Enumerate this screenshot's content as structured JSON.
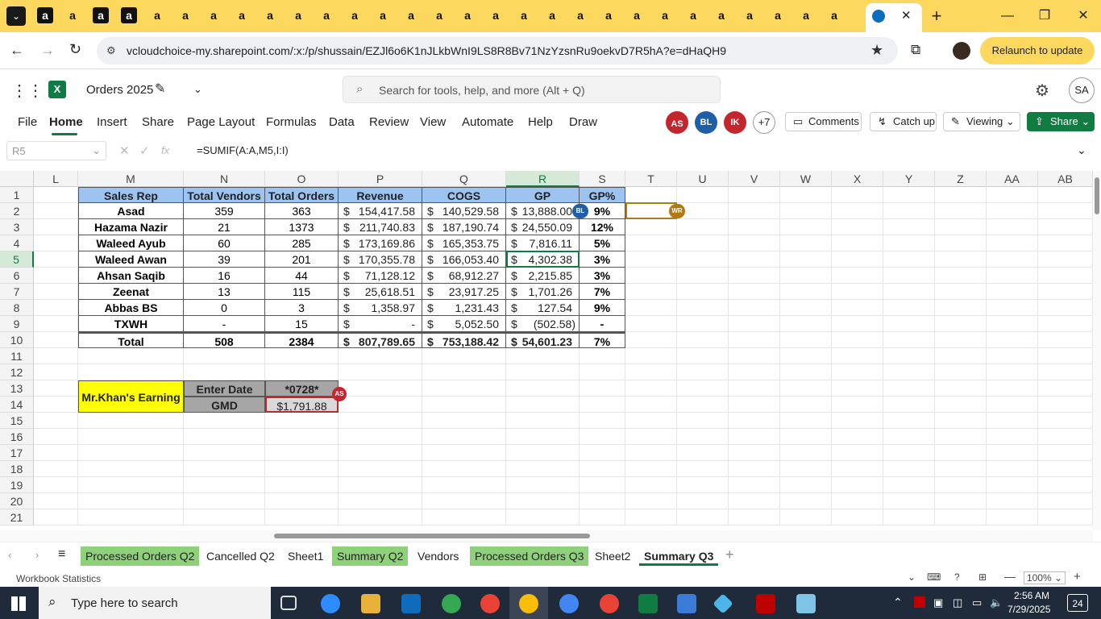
{
  "browser": {
    "url": "vcloudchoice-my.sharepoint.com/:x:/p/shussain/EZJl6o6K1nJLkbWnI9LS8R8Bv71NzYzsnRu9oekvD7R5hA?e=dHaQH9",
    "relaunch_label": "Relaunch to update",
    "tab_icon_letter": "a"
  },
  "app": {
    "title": "Orders 2025",
    "search_placeholder": "Search for tools, help, and more (Alt + Q)",
    "user_initials": "SA"
  },
  "ribbon": {
    "tabs": [
      "File",
      "Home",
      "Insert",
      "Share",
      "Page Layout",
      "Formulas",
      "Data",
      "Review",
      "View",
      "Automate",
      "Help",
      "Draw"
    ],
    "active_tab": "Home",
    "collaborators": [
      {
        "initials": "AS",
        "color": "#c4262e"
      },
      {
        "initials": "BL",
        "color": "#1f5fa8"
      },
      {
        "initials": "IK",
        "color": "#c4262e"
      }
    ],
    "more_collaborators": "+7",
    "comments_label": "Comments",
    "catchup_label": "Catch up",
    "viewing_label": "Viewing",
    "share_label": "Share"
  },
  "formula_bar": {
    "name_box": "R5",
    "fx": "fx",
    "formula": "=SUMIF(A:A,M5,I:I)"
  },
  "columns": [
    "L",
    "M",
    "N",
    "O",
    "P",
    "Q",
    "R",
    "S",
    "T",
    "U",
    "V",
    "W",
    "X",
    "Y",
    "Z",
    "AA",
    "AB"
  ],
  "rows": [
    "1",
    "2",
    "3",
    "4",
    "5",
    "6",
    "7",
    "8",
    "9",
    "10",
    "11",
    "12",
    "13",
    "14",
    "15",
    "16",
    "17",
    "18",
    "19",
    "20",
    "21"
  ],
  "table": {
    "headers": [
      "Sales Rep",
      "Total Vendors",
      "Total Orders",
      "Revenue",
      "COGS",
      "GP",
      "GP%"
    ],
    "rows": [
      [
        "Asad",
        "359",
        "363",
        "154,417.58",
        "140,529.58",
        "13,888.00",
        "9%"
      ],
      [
        "Hazama Nazir",
        "21",
        "1373",
        "211,740.83",
        "187,190.74",
        "24,550.09",
        "12%"
      ],
      [
        "Waleed Ayub",
        "60",
        "285",
        "173,169.86",
        "165,353.75",
        "7,816.11",
        "5%"
      ],
      [
        "Waleed Awan",
        "39",
        "201",
        "170,355.78",
        "166,053.40",
        "4,302.38",
        "3%"
      ],
      [
        "Ahsan Saqib",
        "16",
        "44",
        "71,128.12",
        "68,912.27",
        "2,215.85",
        "3%"
      ],
      [
        "Zeenat",
        "13",
        "115",
        "25,618.51",
        "23,917.25",
        "1,701.26",
        "7%"
      ],
      [
        "Abbas BS",
        "0",
        "3",
        "1,358.97",
        "1,231.43",
        "127.54",
        "9%"
      ],
      [
        "TXWH",
        "-",
        "15",
        "-",
        "5,052.50",
        "(502.58)",
        "-"
      ],
      [
        "Total",
        "508",
        "2384",
        "807,789.65",
        "753,188.42",
        "54,601.23",
        "7%"
      ]
    ],
    "currency_symbol": "$"
  },
  "earning": {
    "title": "Mr.Khan's Earning",
    "enter_date_label": "Enter Date",
    "date_value": "*0728*",
    "gmd_label": "GMD",
    "gmd_value": "$1,791.88"
  },
  "cell_presence": {
    "bl": "BL",
    "wr": "WR",
    "as": "AS"
  },
  "sheets": [
    {
      "name": "Processed Orders Q2",
      "color": "#8fd17a"
    },
    {
      "name": "Cancelled Q2",
      "color": ""
    },
    {
      "name": "Sheet1",
      "color": ""
    },
    {
      "name": "Summary Q2",
      "color": "#8fd17a"
    },
    {
      "name": "Vendors",
      "color": ""
    },
    {
      "name": "Processed Orders Q3",
      "color": "#8fd17a"
    },
    {
      "name": "Sheet2",
      "color": ""
    },
    {
      "name": "Summary Q3",
      "color": ""
    }
  ],
  "active_sheet": "Summary Q3",
  "status": {
    "workbook_stats": "Workbook Statistics",
    "zoom": "100%"
  },
  "taskbar": {
    "search_placeholder": "Type here to search",
    "time": "2:56 AM",
    "date": "7/29/2025",
    "notifications": "24"
  }
}
